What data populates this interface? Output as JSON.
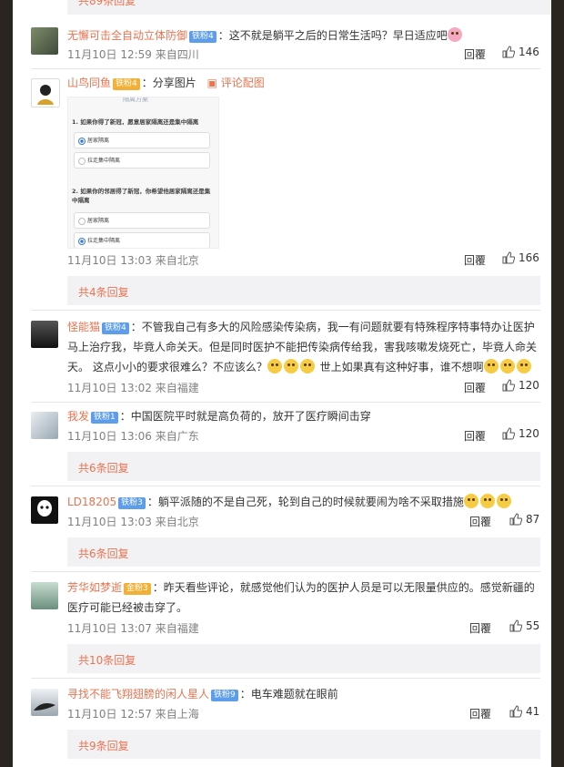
{
  "top_more": "共89条回复",
  "reply_label": "回覆",
  "comments": [
    {
      "user": "无懈可击全自动立体防御",
      "badge": "铁粉4",
      "text": "：这不就是躺平之后的日常生活吗？早日适应吧",
      "time": "11月10日 12:59 来自四川",
      "likes": "146"
    },
    {
      "user": "山鸟同鱼",
      "badge": "铁粉4",
      "text": "：分享图片",
      "pic_link": "评论配图",
      "time": "11月10日 13:03 来自北京",
      "likes": "166",
      "more": "共4条回复",
      "image": {
        "header": "隔离方案",
        "q1": "1. 如果你得了新冠，愿意居家隔离还是集中隔离",
        "q1_opt1": "居家隔离",
        "q1_opt2": "拉走集中隔离",
        "q2": "2. 如果你的邻居得了新冠，你希望他居家隔离还是集中隔离",
        "q2_opt1": "居家隔离",
        "q2_opt2": "拉走集中隔离"
      }
    },
    {
      "user": "怪能猫",
      "badge": "铁粉4",
      "text": "：不管我自己有多大的风险感染传染病，我一有问题就要有特殊程序特事特办让医护马上治疗我，毕竟人命关天。但是同时医护不能把传染病传给我，害我咳嗽发烧死亡，毕竟人命关天。 这点小小的要求很难么？不应该么？",
      "text2": "世上如果真有这种好事，谁不想啊",
      "time": "11月10日 13:02 来自福建",
      "likes": "120"
    },
    {
      "user": "我发",
      "badge": "铁粉1",
      "text": "：中国医院平时就是高负荷的，放开了医疗瞬间击穿",
      "time": "11月10日 13:06 来自广东",
      "likes": "120",
      "more": "共6条回复"
    },
    {
      "user": "LD18205",
      "badge": "铁粉3",
      "text": "：躺平派随的不是自己死，轮到自己的时候就要闹为啥不采取措施",
      "time": "11月10日 13:03 来自北京",
      "likes": "87",
      "more": "共6条回复"
    },
    {
      "user": "芳华如梦逝",
      "badge": "金粉3",
      "text": "：昨天看些评论，就感觉他们认为的医护人员是可以无限量供应的。感觉新疆的医疗可能已经被击穿了。",
      "time": "11月10日 13:07 来自福建",
      "likes": "55",
      "more": "共10条回复"
    },
    {
      "user": "寻找不能飞翔翅膀的闲人星人",
      "badge": "铁粉9",
      "text": "：电车难题就在眼前",
      "time": "11月10日 12:57 来自上海",
      "likes": "41",
      "more": "共9条回复"
    }
  ]
}
